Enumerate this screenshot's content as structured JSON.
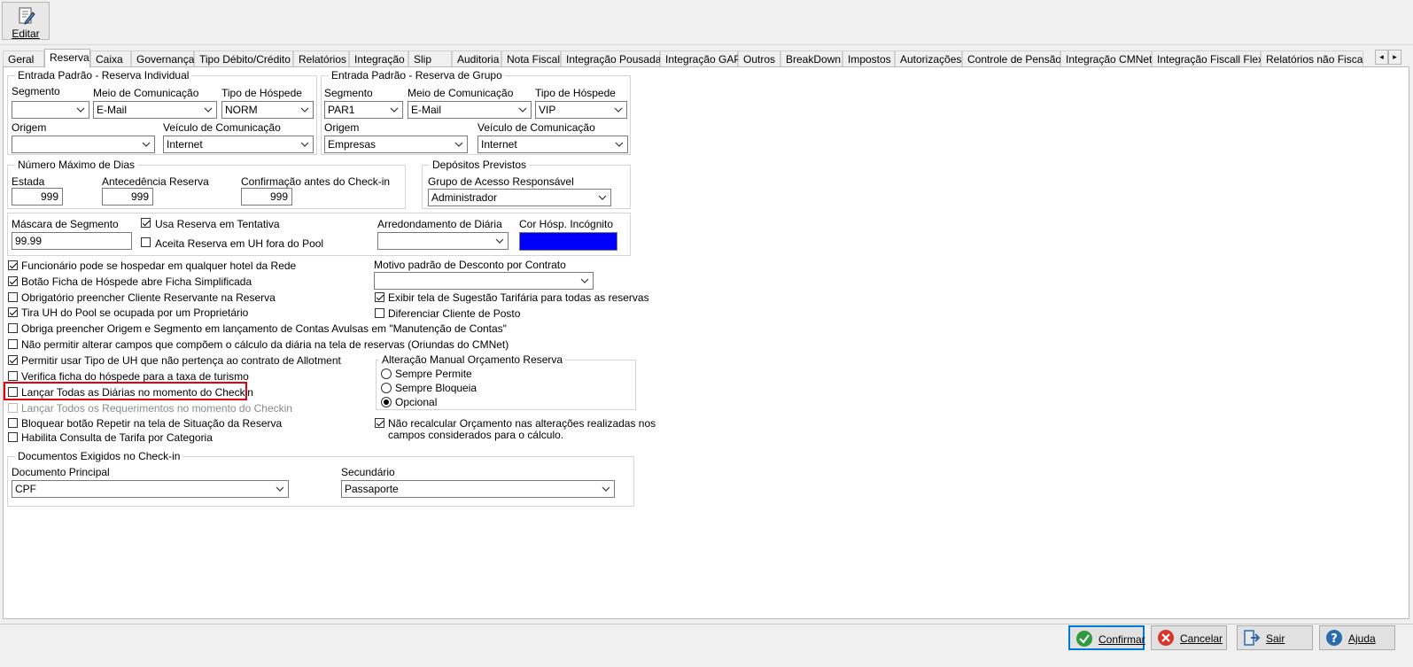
{
  "toolbar": {
    "editar_label": "Editar"
  },
  "tabs": [
    "Geral",
    "Reserva",
    "Caixa",
    "Governança",
    "Tipo Débito/Crédito",
    "Relatórios",
    "Integração",
    "Slip",
    "Auditoria",
    "Nota Fiscal",
    "Integração Pousada",
    "Integração GAP",
    "Outros",
    "BreakDown",
    "Impostos",
    "Autorizações",
    "Controle de Pensão",
    "Integração CMNet",
    "Integração Fiscall Flex",
    "Relatórios não Fisca"
  ],
  "active_tab": "Reserva",
  "tab_arrows": {
    "left": "◂",
    "right": "▸"
  },
  "individual": {
    "title": "Entrada Padrão - Reserva Individual",
    "segmento_label": "Segmento",
    "segmento_value": "",
    "meio_label": "Meio de Comunicação",
    "meio_value": "E-Mail",
    "tipo_label": "Tipo de Hóspede",
    "tipo_value": "NORM",
    "origem_label": "Origem",
    "origem_value": "",
    "veiculo_label": "Veículo de Comunicação",
    "veiculo_value": "Internet"
  },
  "grupo": {
    "title": "Entrada Padrão - Reserva de Grupo",
    "segmento_label": "Segmento",
    "segmento_value": "PAR1",
    "meio_label": "Meio de Comunicação",
    "meio_value": "E-Mail",
    "tipo_label": "Tipo de Hóspede",
    "tipo_value": "VIP",
    "origem_label": "Origem",
    "origem_value": "Empresas",
    "veiculo_label": "Veículo de Comunicação",
    "veiculo_value": "Internet"
  },
  "max_dias": {
    "title": "Número Máximo de Dias",
    "estada_label": "Estada",
    "estada_value": "999",
    "antecedencia_label": "Antecedência Reserva",
    "antecedencia_value": "999",
    "confirmacao_label": "Confirmação antes do Check-in",
    "confirmacao_value": "999"
  },
  "depositos": {
    "title": "Depósitos Previstos",
    "grupo_label": "Grupo de Acesso Responsável",
    "grupo_value": "Administrador"
  },
  "mascara": {
    "label": "Máscara de Segmento",
    "value": "99.99",
    "usa_tentativa": "Usa Reserva em Tentativa",
    "aceita_pool": "Aceita Reserva em UH fora do Pool",
    "arredondamento_label": "Arredondamento de Diária",
    "arredondamento_value": "",
    "cor_label": "Cor Hósp. Incógnito",
    "cor_color": "#0000ff"
  },
  "checks_left": [
    {
      "label": "Funcionário pode se hospedar em qualquer hotel da Rede",
      "checked": true
    },
    {
      "label": "Botão Ficha de Hóspede abre Ficha Simplificada",
      "checked": true
    },
    {
      "label": "Obrigatório preencher Cliente Reservante na Reserva",
      "checked": false
    },
    {
      "label": "Tira UH do Pool se ocupada por um Proprietário",
      "checked": true
    },
    {
      "label": "Obriga preencher Origem e Segmento em lançamento de Contas Avulsas em \"Manutenção de Contas\"",
      "checked": false
    },
    {
      "label": "Não permitir alterar campos que compõem o cálculo da diária na tela de reservas (Oriundas do CMNet)",
      "checked": false
    },
    {
      "label": "Permitir usar Tipo de UH que não pertença ao contrato de Allotment",
      "checked": true
    },
    {
      "label": "Verifica ficha do hóspede para a taxa de turismo",
      "checked": false
    },
    {
      "label": "Lançar Todas as Diárias no momento do Checkin",
      "checked": false
    },
    {
      "label": "Lançar Todos os Requerimentos no momento do Checkin",
      "checked": false,
      "disabled": true
    },
    {
      "label": "Bloquear botão Repetir na tela de Situação da Reserva",
      "checked": false
    },
    {
      "label": "Habilita Consulta de Tarifa por Categoria",
      "checked": false
    }
  ],
  "motivo": {
    "label": "Motivo padrão de Desconto por Contrato",
    "value": ""
  },
  "checks_right": [
    {
      "label": "Exibir tela de Sugestão Tarifária para todas as reservas",
      "checked": true
    },
    {
      "label": "Diferenciar Cliente de Posto",
      "checked": false
    }
  ],
  "orcamento": {
    "title": "Alteração Manual Orçamento Reserva",
    "options": [
      "Sempre Permite",
      "Sempre Bloqueia",
      "Opcional"
    ],
    "selected": "Opcional"
  },
  "nao_recalcular": {
    "line1": "Não recalcular Orçamento nas alterações realizadas nos",
    "line2": "campos considerados para o cálculo.",
    "checked": true
  },
  "documentos": {
    "title": "Documentos Exigidos no Check-in",
    "principal_label": "Documento Principal",
    "principal_value": "CPF",
    "secundario_label": "Secundário",
    "secundario_value": "Passaporte"
  },
  "footer": {
    "confirmar": "Confirmar",
    "cancelar": "Cancelar",
    "sair": "Sair",
    "ajuda": "Ajuda"
  },
  "colors": {
    "confirm": "#2e9b3e",
    "cancel": "#d9342b",
    "sair": "#2b6cb0",
    "ajuda": "#2b6cb0",
    "highlight": "#e3000f"
  },
  "icons": {
    "editar": "edit-document-icon",
    "confirmar": "check-circle-icon",
    "cancelar": "cancel-circle-icon",
    "sair": "exit-door-icon",
    "ajuda": "help-circle-icon"
  }
}
